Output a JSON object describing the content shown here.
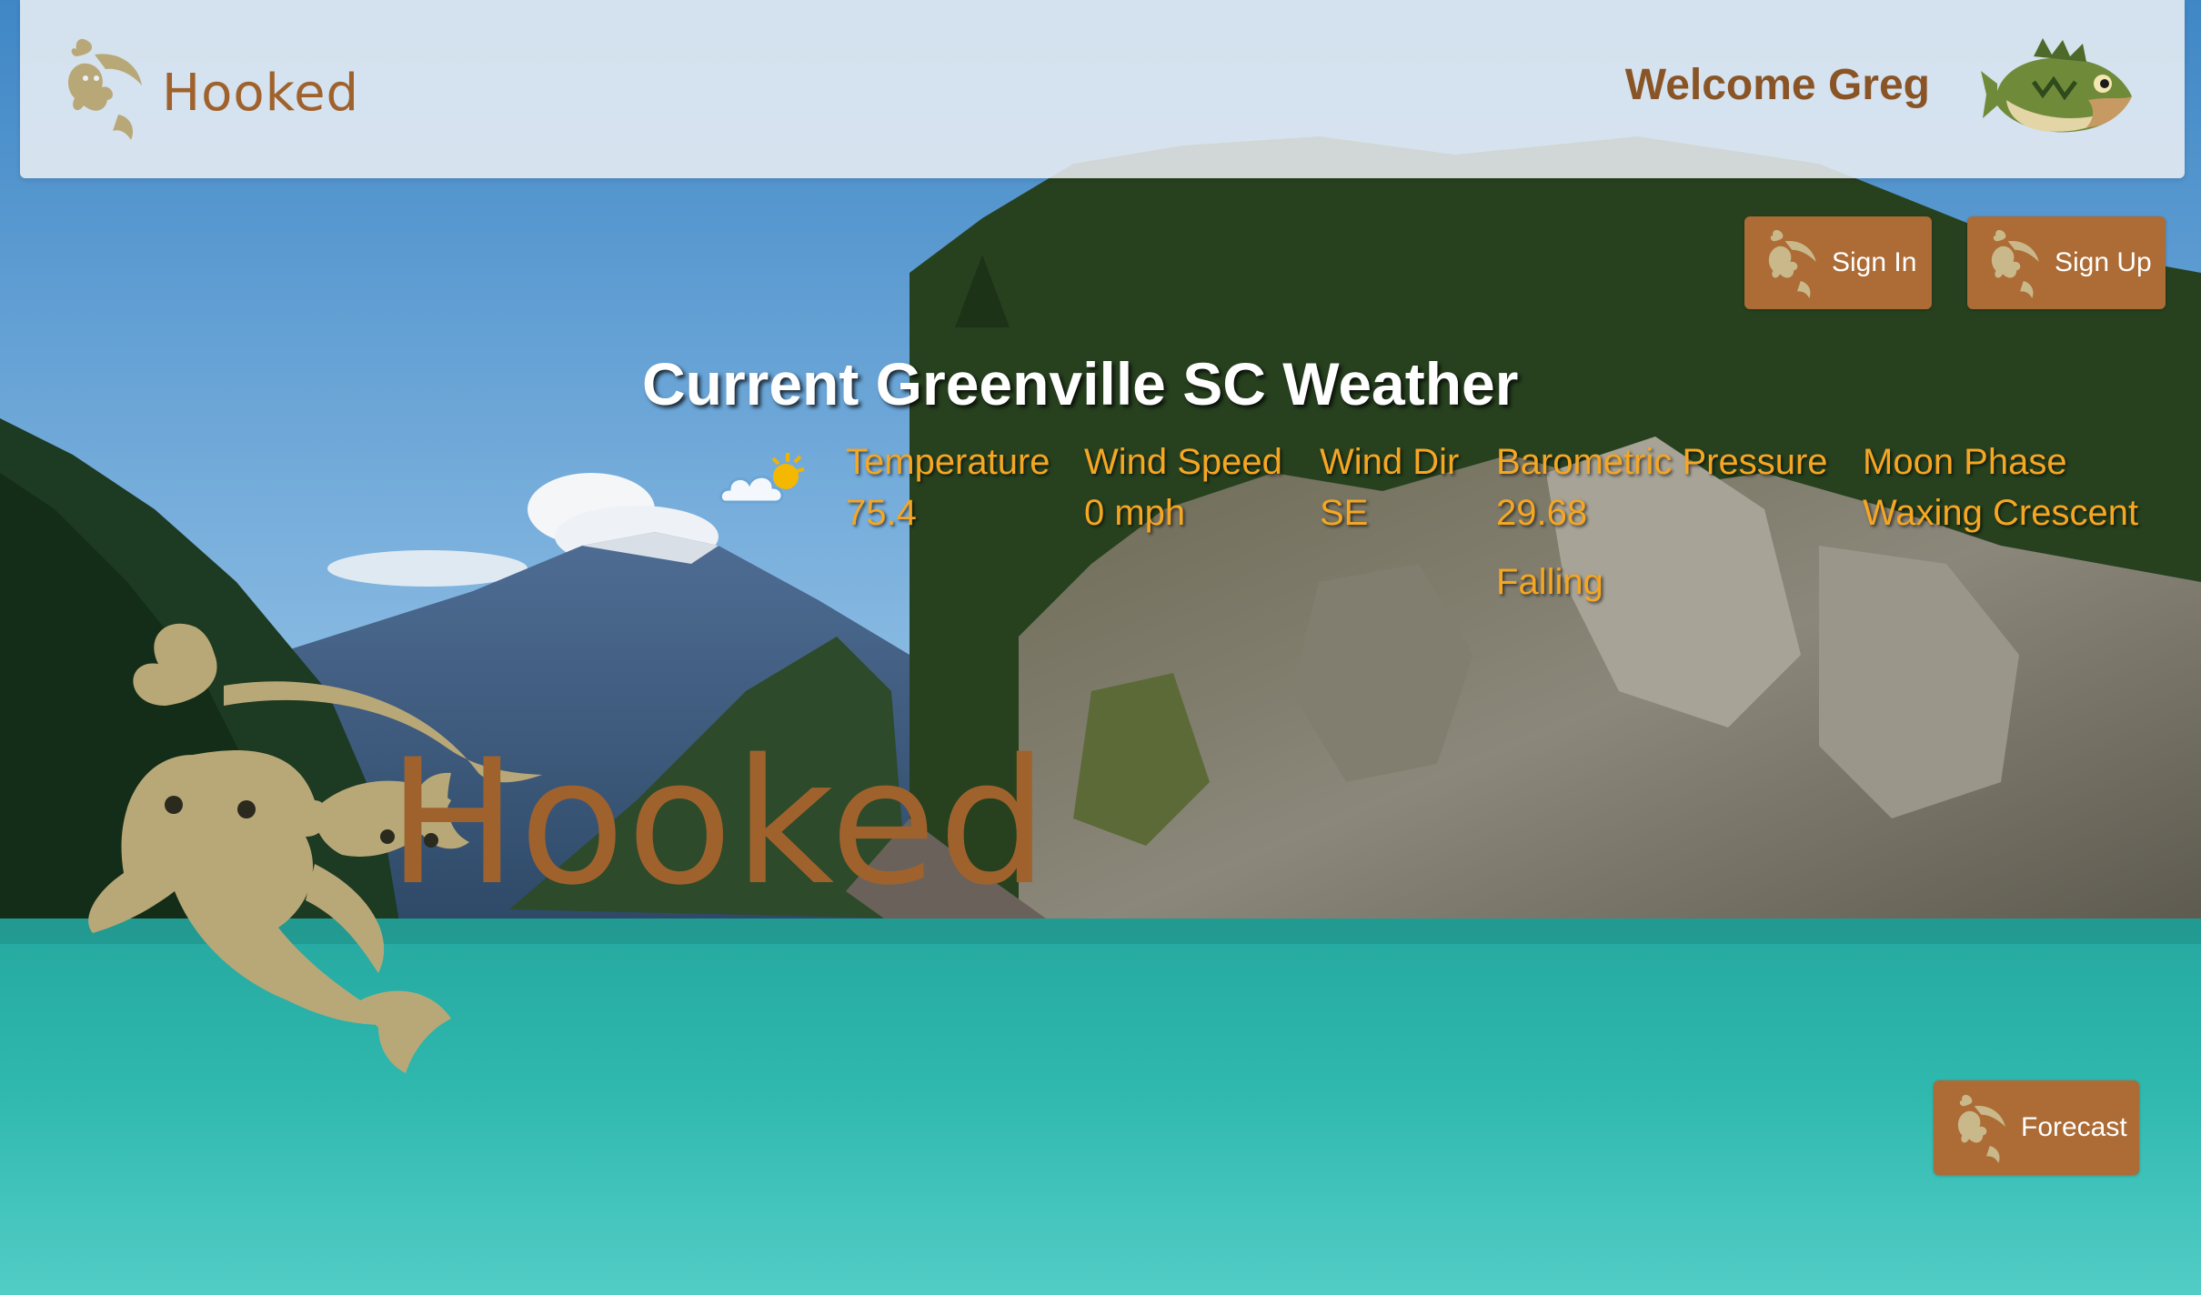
{
  "header": {
    "logo_text": "Hooked",
    "welcome": "Welcome Greg"
  },
  "auth": {
    "sign_in": "Sign In",
    "sign_up": "Sign Up"
  },
  "weather": {
    "title": "Current Greenville SC Weather",
    "icon": "partly-sunny-icon",
    "temperature_label": "Temperature",
    "temperature_value": "75.4",
    "wind_speed_label": "Wind Speed",
    "wind_speed_value": "0 mph",
    "wind_dir_label": "Wind Dir",
    "wind_dir_value": "SE",
    "pressure_label": "Barometric Pressure",
    "pressure_value": "29.68",
    "pressure_trend": "Falling",
    "moon_label": "Moon Phase",
    "moon_value": "Waxing Crescent"
  },
  "hero": {
    "logo_text": "Hooked"
  },
  "forecast": {
    "label": "Forecast"
  },
  "colors": {
    "brand_brown": "#ad6b35",
    "logo_tan": "#b9a877",
    "weather_orange": "#f5a623"
  }
}
